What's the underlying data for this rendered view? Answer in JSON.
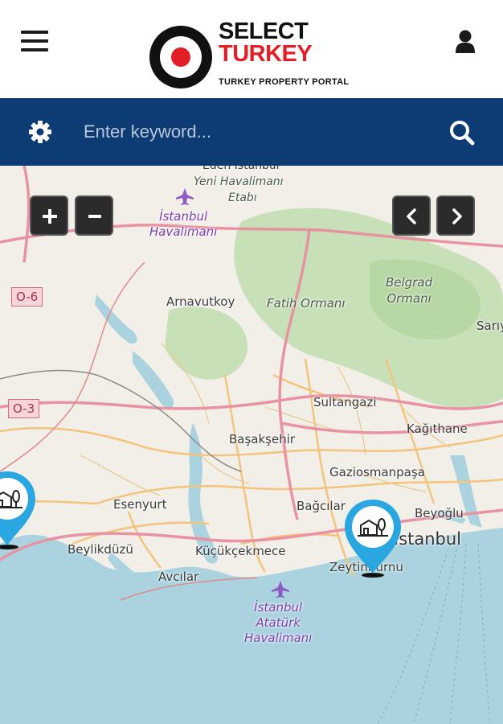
{
  "header": {
    "logo": {
      "line1": "SELECT",
      "line2": "TURKEY",
      "tagline": "TURKEY PROPERTY PORTAL"
    },
    "menu_icon": "hamburger-icon",
    "user_icon": "user-icon"
  },
  "search": {
    "placeholder": "Enter keyword...",
    "value": "",
    "settings_icon": "gear-icon",
    "search_icon": "search-icon"
  },
  "map": {
    "controls": {
      "zoom_in": "+",
      "zoom_out": "−",
      "prev": "‹",
      "next": "›"
    },
    "road_shields": [
      "O-6",
      "O-3"
    ],
    "places": {
      "airport_new_top": "Eden İstanbul",
      "airport_new_1": "Yeni Havalimanı",
      "airport_new_2": "Etabı",
      "airport_1": "İstanbul",
      "airport_2": "Havalimanı",
      "arnavutkoy": "Arnavutkoy",
      "fatih_ormani": "Fatih Ormanı",
      "belgrad_1": "Belgrad",
      "belgrad_2": "Ormanı",
      "sariyer": "Sarıy",
      "sultangazi": "Sultangazi",
      "basaksehir": "Başakşehir",
      "kagithane": "Kağıthane",
      "gaziosmanpasa": "Gaziosmanpaşa",
      "esenyurt": "Esenyurt",
      "bagcilar": "Bağcılar",
      "beyoglu": "Beyoğlu",
      "istanbul": "İstanbul",
      "beylikduzu": "Beylikdüzü",
      "kucukcekmece": "Küçükçekmece",
      "avcilar": "Avcılar",
      "zeytinburnu": "Zeytinburnu",
      "ataturk_1": "İstanbul",
      "ataturk_2": "Atatürk",
      "ataturk_3": "Havalimanı"
    },
    "markers": [
      {
        "type": "property",
        "icon": "house-tree-icon"
      },
      {
        "type": "property",
        "icon": "house-tree-icon"
      }
    ],
    "colors": {
      "water": "#aad3df",
      "land": "#f2efe9",
      "forest": "#add19e",
      "motorway": "#e892a2",
      "primary": "#fcd6a4",
      "marker": "#2aa6e0",
      "header_bar": "#0d3b73",
      "brand_red": "#e41e26"
    }
  }
}
